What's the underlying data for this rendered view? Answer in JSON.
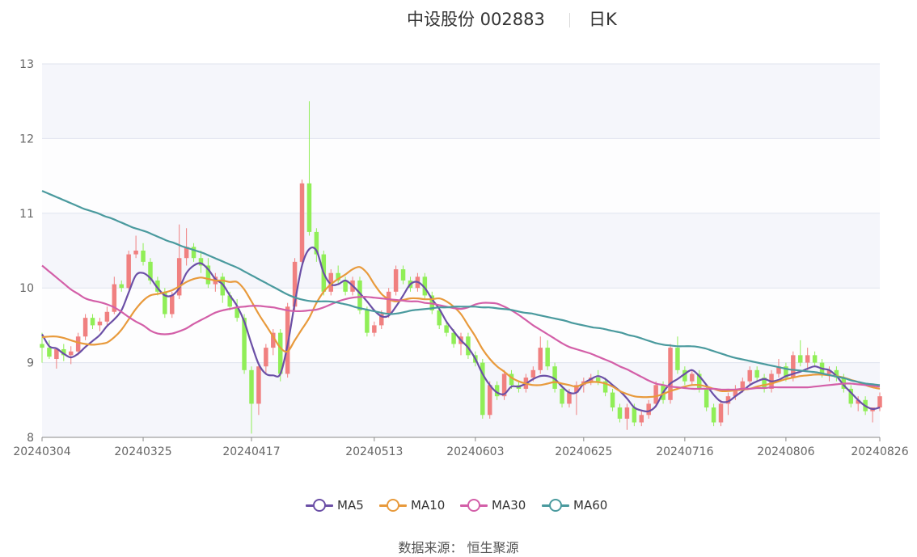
{
  "header": {
    "title": "中设股份 002883",
    "subtitle": "日K"
  },
  "footer": {
    "source": "数据来源： 恒生聚源"
  },
  "colors": {
    "up": "#f08080",
    "down": "#90ee57",
    "MA5": "#6b4fa6",
    "MA10": "#e89a3c",
    "MA30": "#d35fa8",
    "MA60": "#4a9a9e",
    "grid": "#dfe3ee",
    "band": "#f5f6fb"
  },
  "chart_data": {
    "type": "candlestick",
    "title": "中设股份 002883",
    "subtitle": "日K",
    "ylim": [
      8,
      13
    ],
    "yticks": [
      8,
      9,
      10,
      11,
      12,
      13
    ],
    "xticks": [
      "20240304",
      "20240325",
      "20240417",
      "20240513",
      "20240603",
      "20240625",
      "20240716",
      "20240806",
      "20240826"
    ],
    "legend": [
      "MA5",
      "MA10",
      "MA30",
      "MA60"
    ],
    "legend_position": "bottom",
    "candles_ohlc": [
      [
        9.25,
        9.4,
        9.0,
        9.2
      ],
      [
        9.2,
        9.3,
        9.05,
        9.08
      ],
      [
        9.05,
        9.2,
        8.92,
        9.18
      ],
      [
        9.18,
        9.25,
        9.02,
        9.1
      ],
      [
        9.1,
        9.22,
        8.98,
        9.15
      ],
      [
        9.15,
        9.4,
        9.1,
        9.35
      ],
      [
        9.35,
        9.65,
        9.3,
        9.6
      ],
      [
        9.6,
        9.65,
        9.45,
        9.5
      ],
      [
        9.5,
        9.6,
        9.42,
        9.55
      ],
      [
        9.55,
        9.75,
        9.5,
        9.68
      ],
      [
        9.68,
        10.15,
        9.65,
        10.05
      ],
      [
        10.05,
        10.1,
        9.95,
        10.0
      ],
      [
        10.0,
        10.5,
        9.98,
        10.45
      ],
      [
        10.45,
        10.7,
        10.4,
        10.5
      ],
      [
        10.5,
        10.6,
        10.3,
        10.35
      ],
      [
        10.35,
        10.4,
        10.05,
        10.1
      ],
      [
        10.1,
        10.15,
        9.9,
        9.95
      ],
      [
        9.95,
        10.0,
        9.6,
        9.65
      ],
      [
        9.65,
        9.95,
        9.6,
        9.9
      ],
      [
        9.9,
        10.85,
        9.85,
        10.4
      ],
      [
        10.4,
        10.8,
        10.3,
        10.55
      ],
      [
        10.55,
        10.6,
        10.35,
        10.4
      ],
      [
        10.4,
        10.5,
        10.2,
        10.3
      ],
      [
        10.3,
        10.4,
        10.0,
        10.05
      ],
      [
        10.05,
        10.2,
        9.95,
        10.15
      ],
      [
        10.15,
        10.2,
        9.8,
        9.9
      ],
      [
        9.9,
        9.95,
        9.7,
        9.75
      ],
      [
        9.75,
        9.85,
        9.55,
        9.6
      ],
      [
        9.6,
        9.65,
        8.85,
        8.9
      ],
      [
        8.9,
        8.95,
        8.05,
        8.45
      ],
      [
        8.45,
        9.0,
        8.3,
        8.95
      ],
      [
        8.95,
        9.25,
        8.85,
        9.2
      ],
      [
        9.2,
        9.45,
        9.1,
        9.4
      ],
      [
        9.4,
        9.45,
        8.75,
        8.85
      ],
      [
        8.85,
        9.8,
        8.8,
        9.75
      ],
      [
        9.75,
        10.4,
        9.7,
        10.35
      ],
      [
        10.35,
        11.45,
        10.3,
        11.4
      ],
      [
        11.4,
        12.5,
        10.7,
        10.75
      ],
      [
        10.75,
        10.8,
        10.35,
        10.45
      ],
      [
        10.45,
        10.5,
        9.9,
        9.95
      ],
      [
        9.95,
        10.25,
        9.9,
        10.2
      ],
      [
        10.2,
        10.3,
        10.05,
        10.1
      ],
      [
        10.1,
        10.15,
        9.9,
        9.95
      ],
      [
        9.95,
        10.15,
        9.9,
        10.1
      ],
      [
        10.1,
        10.15,
        9.65,
        9.7
      ],
      [
        9.7,
        9.75,
        9.35,
        9.4
      ],
      [
        9.4,
        9.55,
        9.35,
        9.5
      ],
      [
        9.5,
        9.7,
        9.45,
        9.65
      ],
      [
        9.65,
        10.0,
        9.6,
        9.95
      ],
      [
        9.95,
        10.3,
        9.9,
        10.25
      ],
      [
        10.25,
        10.3,
        10.05,
        10.1
      ],
      [
        10.1,
        10.15,
        9.95,
        10.0
      ],
      [
        10.0,
        10.2,
        9.95,
        10.15
      ],
      [
        10.15,
        10.2,
        9.85,
        9.9
      ],
      [
        9.9,
        9.95,
        9.65,
        9.7
      ],
      [
        9.7,
        9.75,
        9.45,
        9.5
      ],
      [
        9.5,
        9.55,
        9.35,
        9.4
      ],
      [
        9.4,
        9.45,
        9.2,
        9.25
      ],
      [
        9.25,
        9.4,
        9.1,
        9.35
      ],
      [
        9.35,
        9.4,
        9.05,
        9.1
      ],
      [
        9.1,
        9.15,
        8.95,
        9.0
      ],
      [
        9.0,
        9.05,
        8.25,
        8.3
      ],
      [
        8.3,
        8.75,
        8.25,
        8.7
      ],
      [
        8.7,
        8.75,
        8.5,
        8.55
      ],
      [
        8.55,
        8.9,
        8.5,
        8.85
      ],
      [
        8.85,
        8.9,
        8.65,
        8.7
      ],
      [
        8.7,
        8.75,
        8.6,
        8.65
      ],
      [
        8.65,
        8.85,
        8.6,
        8.8
      ],
      [
        8.8,
        8.95,
        8.75,
        8.9
      ],
      [
        8.9,
        9.35,
        8.85,
        9.2
      ],
      [
        9.2,
        9.3,
        8.9,
        8.95
      ],
      [
        8.95,
        9.0,
        8.6,
        8.65
      ],
      [
        8.65,
        8.7,
        8.4,
        8.45
      ],
      [
        8.45,
        8.65,
        8.4,
        8.6
      ],
      [
        8.6,
        8.75,
        8.3,
        8.7
      ],
      [
        8.7,
        8.8,
        8.6,
        8.75
      ],
      [
        8.75,
        8.85,
        8.7,
        8.8
      ],
      [
        8.8,
        8.9,
        8.7,
        8.75
      ],
      [
        8.75,
        8.8,
        8.55,
        8.6
      ],
      [
        8.6,
        8.65,
        8.35,
        8.4
      ],
      [
        8.4,
        8.45,
        8.2,
        8.25
      ],
      [
        8.25,
        8.45,
        8.1,
        8.4
      ],
      [
        8.4,
        8.45,
        8.15,
        8.2
      ],
      [
        8.2,
        8.35,
        8.15,
        8.3
      ],
      [
        8.3,
        8.5,
        8.25,
        8.45
      ],
      [
        8.45,
        8.75,
        8.4,
        8.7
      ],
      [
        8.7,
        8.75,
        8.45,
        8.5
      ],
      [
        8.5,
        9.25,
        8.45,
        9.2
      ],
      [
        9.2,
        9.35,
        8.85,
        8.9
      ],
      [
        8.9,
        8.95,
        8.7,
        8.75
      ],
      [
        8.75,
        8.9,
        8.7,
        8.85
      ],
      [
        8.85,
        8.9,
        8.6,
        8.65
      ],
      [
        8.65,
        8.7,
        8.35,
        8.4
      ],
      [
        8.4,
        8.45,
        8.15,
        8.2
      ],
      [
        8.2,
        8.5,
        8.15,
        8.45
      ],
      [
        8.45,
        8.6,
        8.3,
        8.55
      ],
      [
        8.55,
        8.7,
        8.5,
        8.65
      ],
      [
        8.65,
        8.8,
        8.6,
        8.75
      ],
      [
        8.75,
        8.95,
        8.7,
        8.9
      ],
      [
        8.9,
        8.95,
        8.75,
        8.8
      ],
      [
        8.8,
        8.85,
        8.6,
        8.65
      ],
      [
        8.65,
        8.9,
        8.6,
        8.85
      ],
      [
        8.85,
        9.05,
        8.8,
        8.95
      ],
      [
        8.95,
        9.0,
        8.75,
        8.8
      ],
      [
        8.8,
        9.15,
        8.75,
        9.1
      ],
      [
        9.1,
        9.3,
        8.95,
        9.0
      ],
      [
        9.0,
        9.2,
        8.9,
        9.1
      ],
      [
        9.1,
        9.15,
        8.95,
        9.0
      ],
      [
        9.0,
        9.05,
        8.8,
        8.85
      ],
      [
        8.85,
        8.95,
        8.75,
        8.9
      ],
      [
        8.9,
        8.95,
        8.75,
        8.8
      ],
      [
        8.8,
        8.85,
        8.6,
        8.65
      ],
      [
        8.65,
        8.7,
        8.4,
        8.45
      ],
      [
        8.45,
        8.55,
        8.35,
        8.5
      ],
      [
        8.5,
        8.55,
        8.3,
        8.35
      ],
      [
        8.35,
        8.4,
        8.2,
        8.4
      ],
      [
        8.4,
        8.6,
        8.35,
        8.55
      ]
    ],
    "series": [
      {
        "name": "MA5",
        "values": [
          9.38,
          9.22,
          9.19,
          9.12,
          9.07,
          9.12,
          9.21,
          9.29,
          9.37,
          9.49,
          9.58,
          9.7,
          9.94,
          10.17,
          10.2,
          10.13,
          10.0,
          9.9,
          9.9,
          10.0,
          10.2,
          10.3,
          10.33,
          10.25,
          10.12,
          10.05,
          9.9,
          9.76,
          9.55,
          9.25,
          8.98,
          8.85,
          8.83,
          8.85,
          9.24,
          9.8,
          10.3,
          10.52,
          10.5,
          10.2,
          10.05,
          10.05,
          10.1,
          10.03,
          9.93,
          9.82,
          9.7,
          9.62,
          9.63,
          9.75,
          9.9,
          10.05,
          10.08,
          10.0,
          9.85,
          9.72,
          9.55,
          9.42,
          9.3,
          9.2,
          9.05,
          8.85,
          8.7,
          8.6,
          8.58,
          8.68,
          8.68,
          8.72,
          8.78,
          8.82,
          8.82,
          8.78,
          8.68,
          8.6,
          8.6,
          8.72,
          8.78,
          8.82,
          8.78,
          8.7,
          8.62,
          8.52,
          8.4,
          8.36,
          8.35,
          8.42,
          8.6,
          8.72,
          8.78,
          8.85,
          8.9,
          8.82,
          8.7,
          8.57,
          8.48,
          8.48,
          8.55,
          8.62,
          8.7,
          8.75,
          8.78,
          8.75,
          8.77,
          8.82,
          8.85,
          8.88,
          8.92,
          8.95,
          8.92,
          8.9,
          8.82,
          8.7,
          8.6,
          8.5,
          8.42,
          8.38,
          8.4
        ]
      },
      {
        "name": "MA10",
        "values": [
          9.34,
          9.35,
          9.35,
          9.33,
          9.3,
          9.27,
          9.25,
          9.24,
          9.25,
          9.27,
          9.34,
          9.44,
          9.58,
          9.72,
          9.83,
          9.9,
          9.92,
          9.94,
          9.97,
          10.02,
          10.08,
          10.12,
          10.14,
          10.12,
          10.1,
          10.1,
          10.08,
          10.08,
          9.98,
          9.82,
          9.65,
          9.5,
          9.35,
          9.2,
          9.15,
          9.3,
          9.45,
          9.6,
          9.8,
          9.95,
          10.05,
          10.12,
          10.18,
          10.25,
          10.28,
          10.2,
          10.05,
          9.92,
          9.85,
          9.82,
          9.84,
          9.86,
          9.86,
          9.85,
          9.85,
          9.86,
          9.82,
          9.75,
          9.65,
          9.5,
          9.35,
          9.18,
          9.05,
          8.95,
          8.88,
          8.8,
          8.75,
          8.72,
          8.7,
          8.7,
          8.72,
          8.74,
          8.72,
          8.7,
          8.68,
          8.72,
          8.74,
          8.74,
          8.72,
          8.68,
          8.62,
          8.58,
          8.55,
          8.54,
          8.54,
          8.55,
          8.58,
          8.62,
          8.65,
          8.68,
          8.7,
          8.7,
          8.68,
          8.65,
          8.62,
          8.62,
          8.63,
          8.64,
          8.65,
          8.68,
          8.7,
          8.72,
          8.75,
          8.78,
          8.8,
          8.82,
          8.83,
          8.84,
          8.84,
          8.83,
          8.82,
          8.8,
          8.77,
          8.74,
          8.7,
          8.67,
          8.65
        ]
      },
      {
        "name": "MA30",
        "values": [
          10.3,
          10.22,
          10.14,
          10.06,
          9.98,
          9.92,
          9.86,
          9.83,
          9.81,
          9.78,
          9.74,
          9.68,
          9.61,
          9.55,
          9.5,
          9.43,
          9.39,
          9.38,
          9.39,
          9.42,
          9.46,
          9.52,
          9.57,
          9.62,
          9.67,
          9.7,
          9.72,
          9.74,
          9.75,
          9.76,
          9.76,
          9.75,
          9.74,
          9.72,
          9.7,
          9.69,
          9.69,
          9.7,
          9.71,
          9.74,
          9.78,
          9.82,
          9.85,
          9.87,
          9.88,
          9.88,
          9.87,
          9.86,
          9.85,
          9.84,
          9.83,
          9.82,
          9.82,
          9.8,
          9.79,
          9.77,
          9.75,
          9.73,
          9.72,
          9.74,
          9.78,
          9.8,
          9.8,
          9.79,
          9.75,
          9.7,
          9.64,
          9.57,
          9.5,
          9.44,
          9.38,
          9.32,
          9.26,
          9.21,
          9.18,
          9.15,
          9.12,
          9.08,
          9.04,
          9.0,
          8.95,
          8.91,
          8.86,
          8.81,
          8.76,
          8.72,
          8.7,
          8.68,
          8.67,
          8.66,
          8.65,
          8.65,
          8.65,
          8.65,
          8.64,
          8.64,
          8.64,
          8.65,
          8.65,
          8.66,
          8.66,
          8.67,
          8.67,
          8.67,
          8.67,
          8.67,
          8.67,
          8.68,
          8.69,
          8.7,
          8.71,
          8.72,
          8.72,
          8.71,
          8.7,
          8.69,
          8.68
        ]
      },
      {
        "name": "MA60",
        "values": [
          11.3,
          11.26,
          11.22,
          11.18,
          11.14,
          11.1,
          11.06,
          11.03,
          11.0,
          10.96,
          10.93,
          10.89,
          10.85,
          10.81,
          10.78,
          10.75,
          10.71,
          10.67,
          10.63,
          10.6,
          10.56,
          10.53,
          10.5,
          10.47,
          10.43,
          10.39,
          10.35,
          10.31,
          10.27,
          10.22,
          10.17,
          10.12,
          10.07,
          10.02,
          9.97,
          9.92,
          9.88,
          9.85,
          9.83,
          9.82,
          9.82,
          9.82,
          9.81,
          9.79,
          9.77,
          9.74,
          9.72,
          9.7,
          9.68,
          9.66,
          9.65,
          9.66,
          9.68,
          9.7,
          9.71,
          9.72,
          9.73,
          9.74,
          9.74,
          9.75,
          9.75,
          9.75,
          9.75,
          9.74,
          9.74,
          9.73,
          9.72,
          9.71,
          9.69,
          9.67,
          9.66,
          9.64,
          9.62,
          9.6,
          9.58,
          9.56,
          9.53,
          9.51,
          9.49,
          9.47,
          9.46,
          9.44,
          9.42,
          9.4,
          9.37,
          9.35,
          9.32,
          9.29,
          9.26,
          9.24,
          9.23,
          9.22,
          9.22,
          9.22,
          9.21,
          9.19,
          9.16,
          9.13,
          9.1,
          9.07,
          9.05,
          9.03,
          9.01,
          8.99,
          8.97,
          8.95,
          8.93,
          8.91,
          8.9,
          8.89,
          8.88,
          8.87,
          8.85,
          8.83,
          8.81,
          8.79,
          8.76,
          8.74,
          8.72,
          8.71,
          8.7
        ]
      }
    ]
  }
}
